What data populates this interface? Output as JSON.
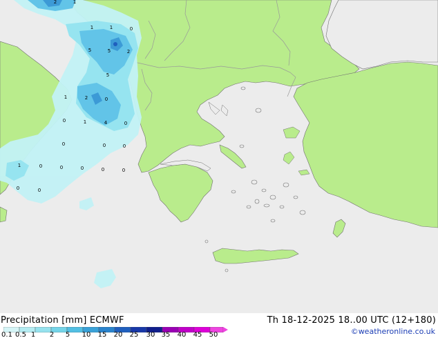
{
  "header": {
    "title": "Precipitation [mm]",
    "model": "ECMWF",
    "datetime": "Th 18-12-2025 18..00 UTC (12+180)",
    "credit": "©weatheronline.co.uk"
  },
  "legend": {
    "labels": [
      "0.1",
      "0.5",
      "1",
      "2",
      "5",
      "10",
      "15",
      "20",
      "25",
      "30",
      "35",
      "40",
      "45",
      "50"
    ],
    "colors": [
      "#d5f5f7",
      "#b4ecf2",
      "#96e2ee",
      "#74d4e8",
      "#52bfe3",
      "#3aa2d8",
      "#2a83cc",
      "#1f5fbe",
      "#1838a8",
      "#101e8c",
      "#9a00b4",
      "#c000c8",
      "#dd00d8",
      "#ee44e0"
    ]
  },
  "map": {
    "colors": {
      "sea": "#ececec",
      "land": "#b9ec8c",
      "border": "#999999",
      "coast": "#707070",
      "precip_light": "#c2f2f6",
      "precip_mid": "#96e4f0",
      "precip_heavy": "#62c4e8",
      "precip_strong": "#3c9ad6"
    },
    "values": [
      "2",
      "1",
      "1",
      "1",
      "0",
      "5",
      "5",
      "2",
      "5",
      "1",
      "2",
      "0",
      "0",
      "1",
      "4",
      "0",
      "0",
      "0",
      "0",
      "1",
      "0",
      "0",
      "0",
      "0",
      "0",
      "0",
      "0"
    ]
  }
}
